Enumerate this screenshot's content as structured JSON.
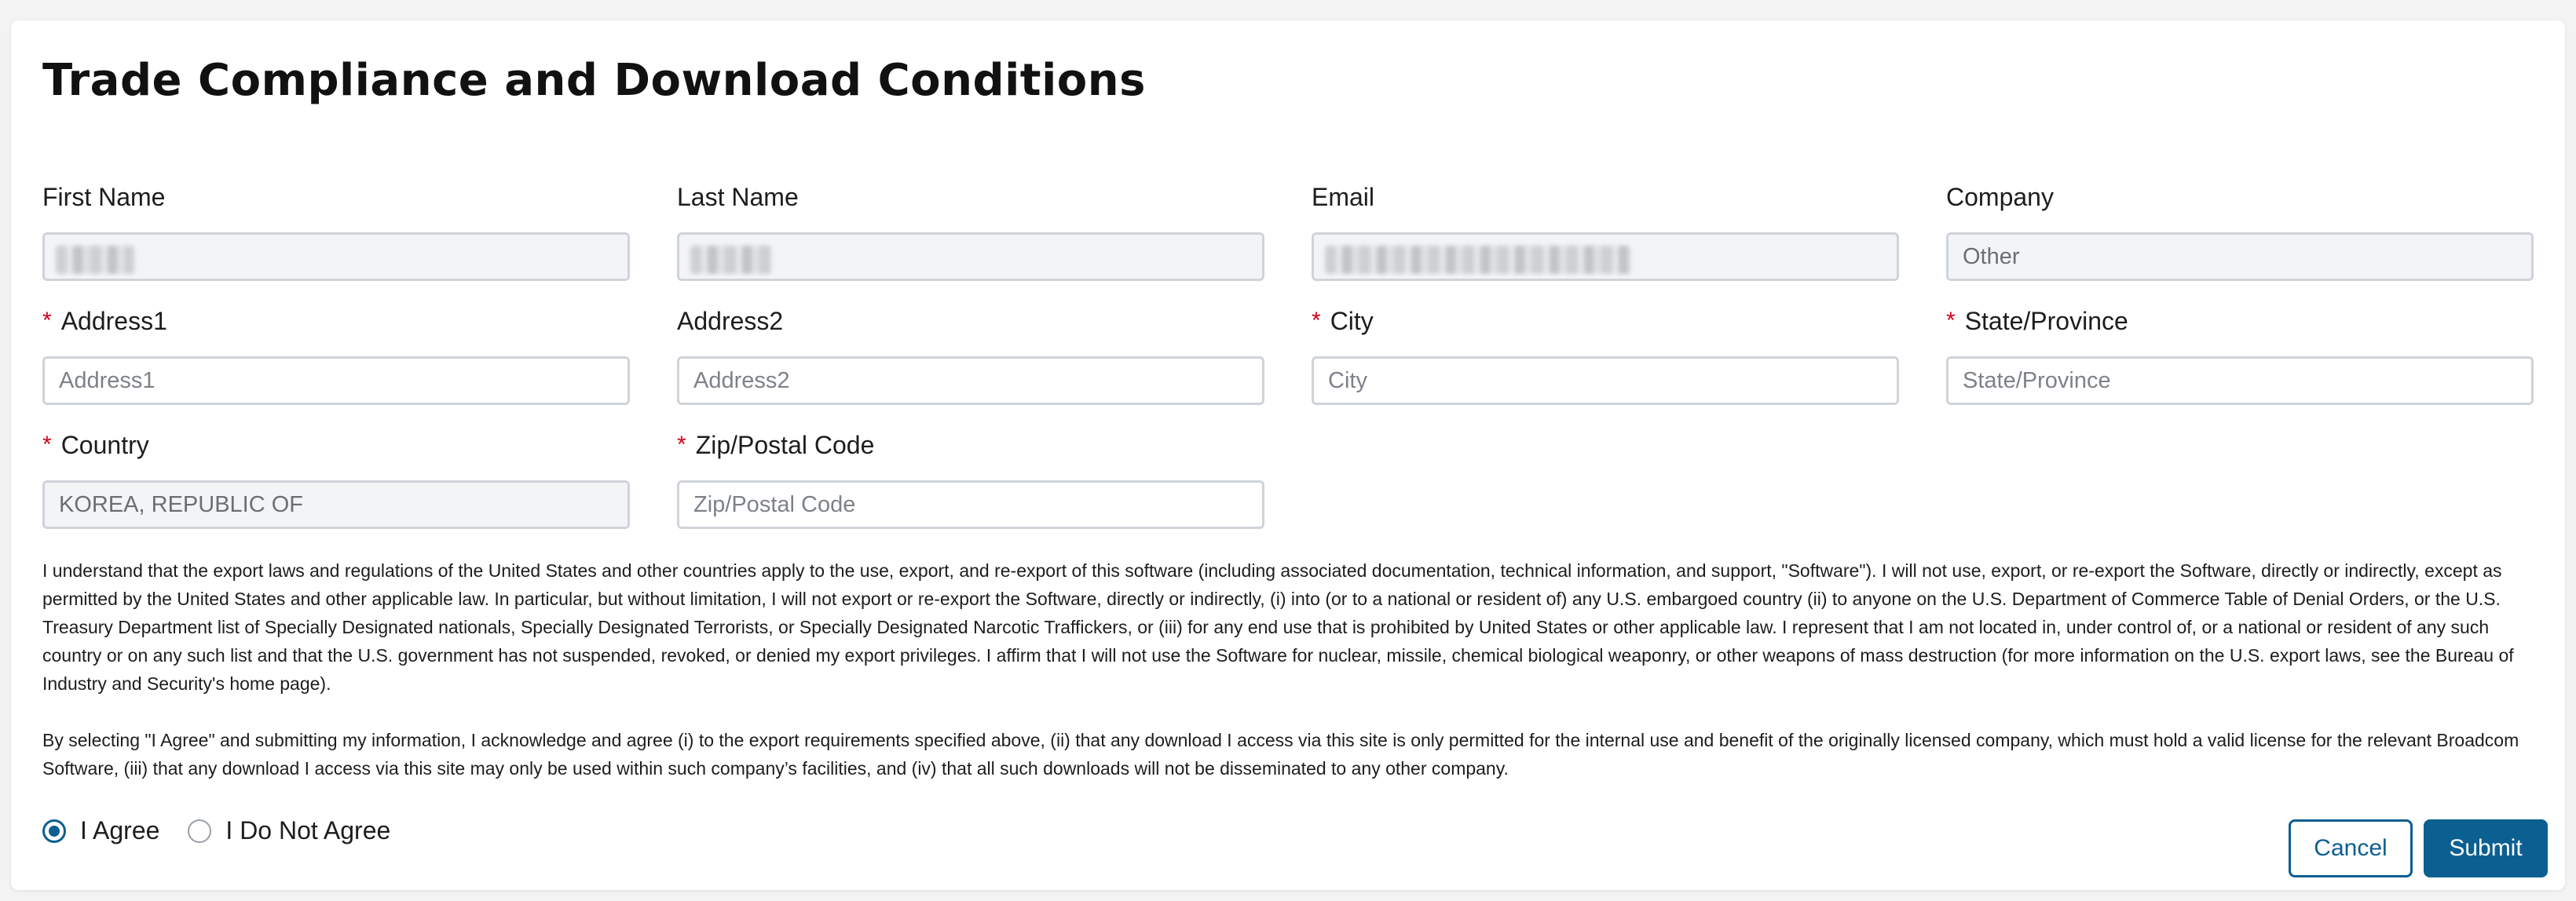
{
  "page": {
    "title": "Trade Compliance and Download Conditions"
  },
  "form": {
    "fields": [
      {
        "label": "First Name",
        "required": false,
        "value": "",
        "placeholder": "",
        "disabled": true,
        "redacted": true
      },
      {
        "label": "Last Name",
        "required": false,
        "value": "",
        "placeholder": "",
        "disabled": true,
        "redacted": true
      },
      {
        "label": "Email",
        "required": false,
        "value": "",
        "placeholder": "",
        "disabled": true,
        "redacted": true
      },
      {
        "label": "Company",
        "required": false,
        "value": "Other",
        "placeholder": "",
        "disabled": true
      },
      {
        "label": "Address1",
        "required": true,
        "value": "",
        "placeholder": "Address1",
        "disabled": false
      },
      {
        "label": "Address2",
        "required": false,
        "value": "",
        "placeholder": "Address2",
        "disabled": false
      },
      {
        "label": "City",
        "required": true,
        "value": "",
        "placeholder": "City",
        "disabled": false
      },
      {
        "label": "State/Province",
        "required": true,
        "value": "",
        "placeholder": "State/Province",
        "disabled": false
      },
      {
        "label": "Country",
        "required": true,
        "value": "KOREA, REPUBLIC OF",
        "placeholder": "",
        "disabled": true
      },
      {
        "label": "Zip/Postal Code",
        "required": true,
        "value": "",
        "placeholder": "Zip/Postal Code",
        "disabled": false
      }
    ],
    "required_marker": "*"
  },
  "terms": {
    "export_paragraph": "I understand that the export laws and regulations of the United States and other countries apply to the use, export, and re-export of this software (including associated documentation, technical information, and support, \"Software\"). I will not use, export, or re-export the Software, directly or indirectly, except as permitted by the United States and other applicable law. In particular, but without limitation, I will not export or re-export the Software, directly or indirectly, (i) into (or to a national or resident of) any U.S. embargoed country (ii) to anyone on the U.S. Department of Commerce Table of Denial Orders, or the U.S. Treasury Department list of Specially Designated nationals, Specially Designated Terrorists, or Specially Designated Narcotic Traffickers, or (iii) for any end use that is prohibited by United States or other applicable law. I represent that I am not located in, under control of, or a national or resident of any such country or on any such list and that the U.S. government has not suspended, revoked, or denied my export privileges. I affirm that I will not use the Software for nuclear, missile, chemical biological weaponry, or other weapons of mass destruction (for more information on the U.S. export laws, see the Bureau of Industry and Security's home page).",
    "agree_paragraph": "By selecting \"I Agree\" and submitting my information, I acknowledge and agree (i) to the export requirements specified above, (ii) that any download I access via this site is only permitted for the internal use and benefit of the originally licensed company, which must hold a valid license for the relevant Broadcom Software, (iii) that any download I access via this site may only be used within such company’s facilities, and (iv) that all such downloads will not be disseminated to any other company."
  },
  "agreement": {
    "options": [
      {
        "label": "I Agree",
        "selected": true
      },
      {
        "label": "I Do Not Agree",
        "selected": false
      }
    ]
  },
  "actions": {
    "cancel_label": "Cancel",
    "submit_label": "Submit"
  },
  "colors": {
    "accent": "#0b5f91",
    "required": "#d0021b",
    "border": "#cfd4d9",
    "disabled_bg": "#f3f4f6"
  }
}
